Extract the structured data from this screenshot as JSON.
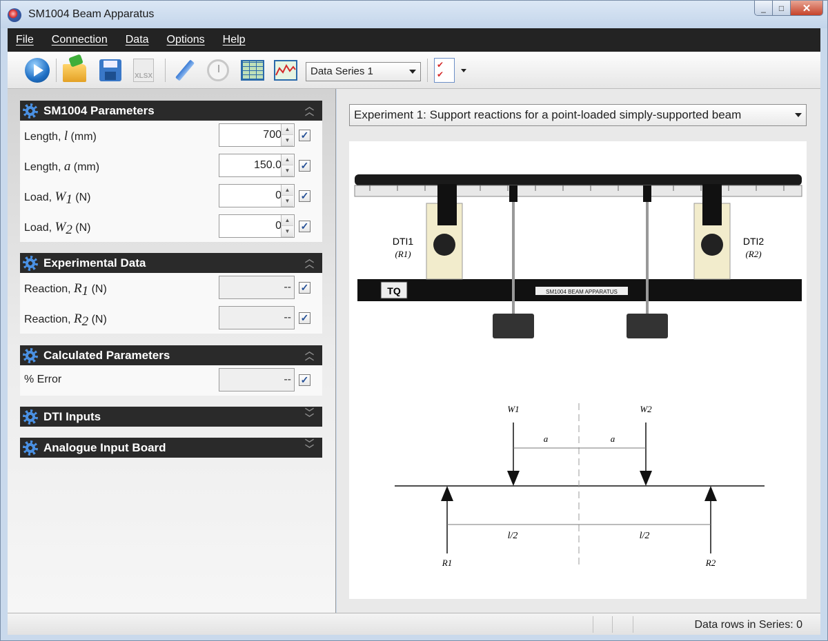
{
  "window": {
    "title": "SM1004 Beam Apparatus",
    "minimize": "_",
    "maximize": "□",
    "close": "✕"
  },
  "menu": [
    "File",
    "Connection",
    "Data",
    "Options",
    "Help"
  ],
  "toolbar": {
    "xlsx_label": "XLSX",
    "series_select": "Data Series 1"
  },
  "sections": {
    "parameters": {
      "title": "SM1004 Parameters",
      "rows": [
        {
          "label": "Length, ",
          "sym": "l",
          "sub": "",
          "unit": "  (mm)",
          "value": "700"
        },
        {
          "label": "Length, ",
          "sym": "a",
          "sub": "",
          "unit": "  (mm)",
          "value": "150.0"
        },
        {
          "label": "Load, ",
          "sym": "W",
          "sub": "1",
          "unit": "  (N)",
          "value": "0"
        },
        {
          "label": "Load, ",
          "sym": "W",
          "sub": "2",
          "unit": "  (N)",
          "value": "0"
        }
      ]
    },
    "experimental": {
      "title": "Experimental Data",
      "rows": [
        {
          "label": "Reaction, ",
          "sym": "R",
          "sub": "1",
          "unit": "  (N)",
          "value": "--"
        },
        {
          "label": "Reaction, ",
          "sym": "R",
          "sub": "2",
          "unit": "  (N)",
          "value": "--"
        }
      ]
    },
    "calculated": {
      "title": "Calculated Parameters",
      "rows": [
        {
          "label": "% Error",
          "value": "--"
        }
      ]
    },
    "dti": {
      "title": "DTI Inputs"
    },
    "analogue": {
      "title": "Analogue Input Board"
    }
  },
  "checkmark": "✓",
  "experiment_select": "Experiment 1: Support reactions for a point-loaded simply-supported beam",
  "diagram": {
    "dti1": "DTI1",
    "dti1_r": "(R1)",
    "dti2": "DTI2",
    "dti2_r": "(R2)",
    "beam_label": "SM1004 BEAM APPARATUS",
    "logo": "TQ",
    "w1": "W1",
    "w2": "W2",
    "a1": "a",
    "a2": "a",
    "l1": "l/2",
    "l2": "l/2",
    "r1": "R1",
    "r2": "R2"
  },
  "status": {
    "text": "Data rows in Series: 0"
  }
}
